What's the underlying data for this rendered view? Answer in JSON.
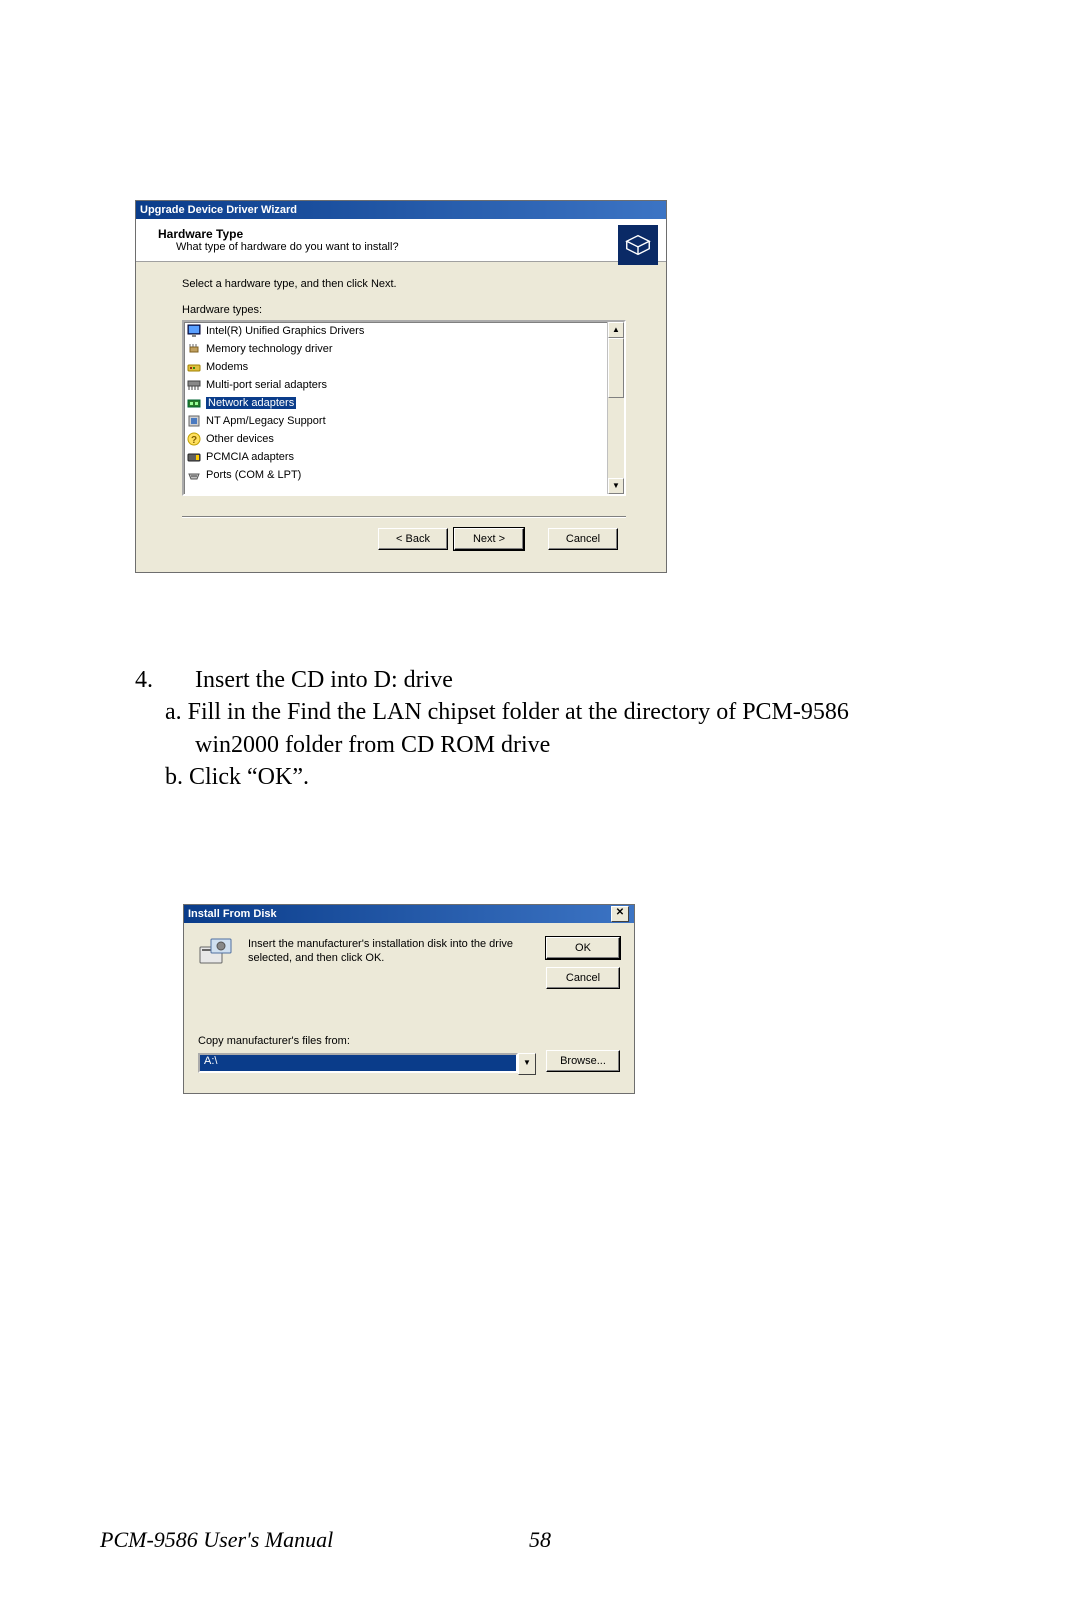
{
  "wizard": {
    "title": "Upgrade Device Driver Wizard",
    "heading": "Hardware Type",
    "subheading": "What type of hardware do you want to install?",
    "instruction": "Select a hardware type, and then click Next.",
    "list_label": "Hardware types:",
    "items": [
      {
        "label": "Intel(R) Unified Graphics Drivers",
        "icon": "monitor"
      },
      {
        "label": "Memory technology driver",
        "icon": "chip"
      },
      {
        "label": "Modems",
        "icon": "modem"
      },
      {
        "label": "Multi-port serial adapters",
        "icon": "serial"
      },
      {
        "label": "Network adapters",
        "icon": "network",
        "selected": true
      },
      {
        "label": "NT Apm/Legacy Support",
        "icon": "legacy"
      },
      {
        "label": "Other devices",
        "icon": "question"
      },
      {
        "label": "PCMCIA adapters",
        "icon": "pcmcia"
      },
      {
        "label": "Ports (COM & LPT)",
        "icon": "port"
      }
    ],
    "buttons": {
      "back": "< Back",
      "next": "Next >",
      "cancel": "Cancel"
    }
  },
  "document": {
    "step_num": "4.",
    "step_text": "Insert the CD into D: drive",
    "sub_a": "a. Fill in the Find the LAN chipset folder at the directory of PCM-9586 win2000 folder from CD ROM drive",
    "sub_b": "b. Click “OK”.",
    "footer_left": "PCM-9586 User's Manual",
    "page_number": "58"
  },
  "install": {
    "title": "Install From Disk",
    "message": "Insert the manufacturer's installation disk into the drive selected, and then click OK.",
    "copy_label": "Copy manufacturer's files from:",
    "path_value": "A:\\",
    "buttons": {
      "ok": "OK",
      "cancel": "Cancel",
      "browse": "Browse..."
    }
  }
}
